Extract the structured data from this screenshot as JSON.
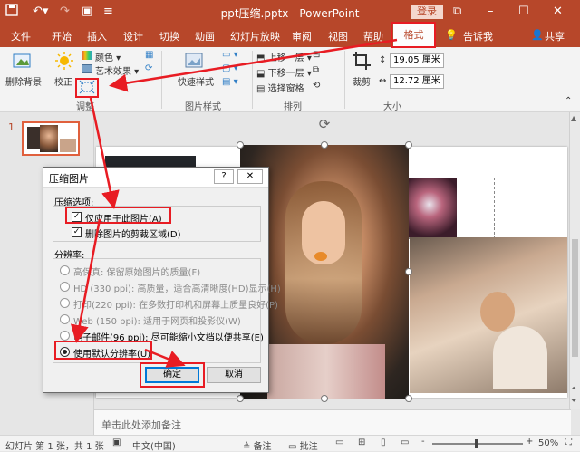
{
  "titlebar": {
    "title": "ppt压缩.pptx  -  PowerPoint",
    "save_icon": "save-icon",
    "login": "登录",
    "minimize": "–",
    "maximize": "☐",
    "close": "✕",
    "restore": "⧉"
  },
  "tabs": [
    "文件",
    "开始",
    "插入",
    "设计",
    "切换",
    "动画",
    "幻灯片放映",
    "审阅",
    "视图",
    "帮助"
  ],
  "active_tab": "格式",
  "tell_me": "告诉我",
  "share": "共享",
  "ribbon": {
    "remove_bg": "删除背景",
    "correct": "校正",
    "color": "颜色 ▾",
    "art_effects": "艺术效果 ▾",
    "adjust_group": "调整",
    "quick_styles": "快速样式",
    "picture_styles_group": "图片样式",
    "bring_forward": "上移一层 ▾",
    "send_backward": "下移一层 ▾",
    "selection_pane": "选择窗格",
    "arrange_group": "排列",
    "crop": "裁剪",
    "height": "19.05 厘米",
    "width": "12.72 厘米",
    "size_group": "大小"
  },
  "thumbnail": {
    "number": "1"
  },
  "dialog": {
    "title": "压缩图片",
    "help": "?",
    "close": "✕",
    "options_label": "压缩选项:",
    "opt1": "仅应用于此图片(A)",
    "opt2": "删除图片的剪裁区域(D)",
    "resolution_label": "分辨率:",
    "res": [
      "高保真: 保留原始图片的质量(F)",
      "HD (330 ppi): 高质量，适合高清晰度(HD)显示(H)",
      "打印(220 ppi): 在多数打印机和屏幕上质量良好(P)",
      "Web (150 ppi): 适用于网页和投影仪(W)",
      "电子邮件(96 ppi): 尽可能缩小文档以便共享(E)",
      "使用默认分辨率(U)"
    ],
    "ok": "确定",
    "cancel": "取消"
  },
  "notes": "单击此处添加备注",
  "status": {
    "slide_info": "幻灯片 第 1 张，共 1 张",
    "lang": "中文(中国)",
    "notes_btn": "≜ 备注",
    "comments_btn": "▭ 批注",
    "zoom": "50%",
    "zoom_minus": "-",
    "zoom_plus": "+"
  },
  "colors": {
    "accent": "#b7472a",
    "highlight": "#e81c23"
  }
}
